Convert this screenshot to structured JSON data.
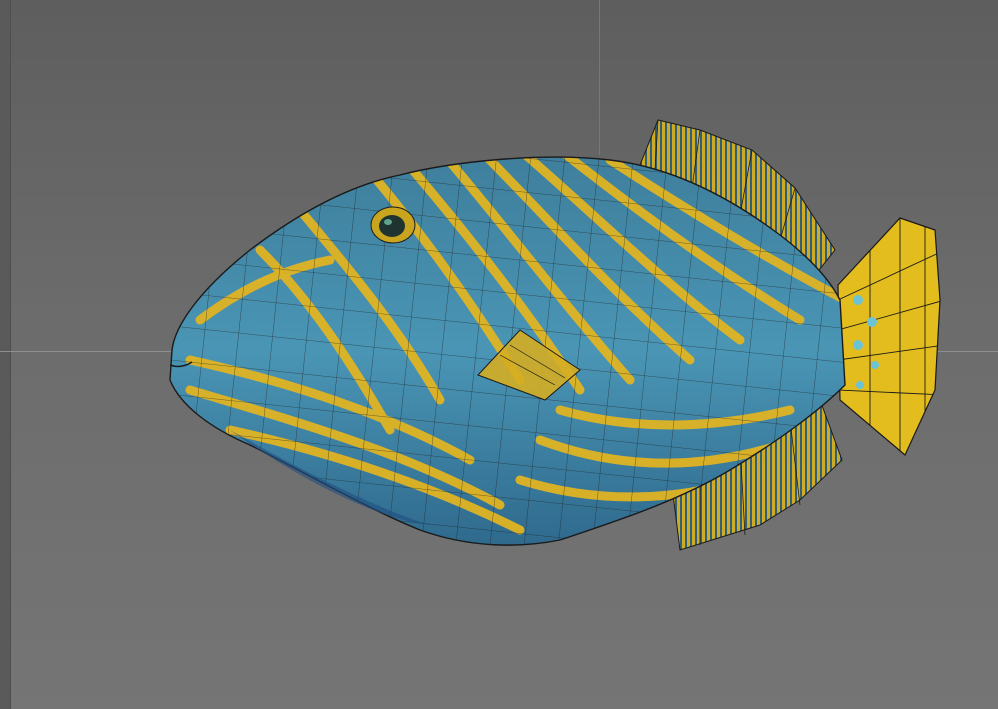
{
  "viewport": {
    "background": "#6b6b6b",
    "axis_y_color": "#1fb51f",
    "axis_x_color": "#8e8e8e"
  },
  "model": {
    "subject": "triggerfish",
    "display_mode": "textured-with-wireframe",
    "colors": {
      "body_blue": "#3f87a8",
      "stripe_yellow": "#e0b422",
      "fin_yellow": "#e8c21a",
      "wire": "#1c1c1c"
    }
  }
}
